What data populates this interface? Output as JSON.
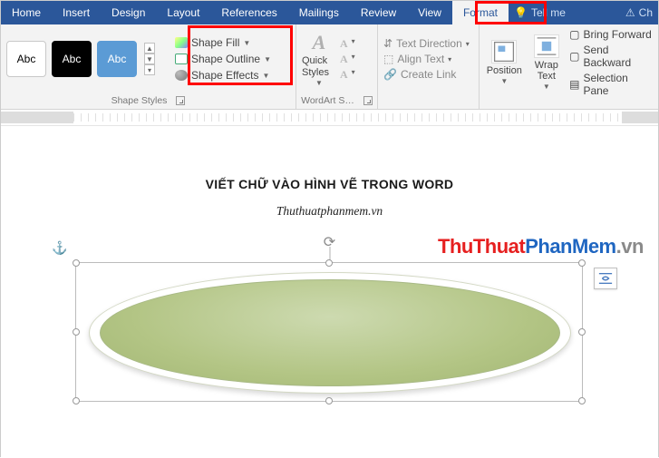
{
  "tabs": {
    "home": "Home",
    "insert": "Insert",
    "design": "Design",
    "layout": "Layout",
    "references": "References",
    "mailings": "Mailings",
    "review": "Review",
    "view": "View",
    "format": "Format",
    "tellme": "Tell me"
  },
  "ribbon": {
    "shape_styles": {
      "label": "Shape Styles",
      "swatch_text": "Abc",
      "fill": "Shape Fill",
      "outline": "Shape Outline",
      "effects": "Shape Effects"
    },
    "wordart_styles": {
      "label": "WordArt S…",
      "quick_styles": "Quick Styles"
    },
    "text": {
      "direction": "Text Direction",
      "align": "Align Text",
      "create_link": "Create Link"
    },
    "arrange": {
      "position": "Position",
      "wrap_text": "Wrap Text",
      "bring_forward": "Bring Forward",
      "send_backward": "Send Backward",
      "selection_pane": "Selection Pane"
    },
    "chrome_right": "Ch"
  },
  "document": {
    "heading": "VIẾT CHỮ VÀO HÌNH VẼ TRONG WORD",
    "subheading": "Thuthuatphanmem.vn"
  },
  "watermark": {
    "a": "ThuThuat",
    "b": "PhanMem",
    "c": ".vn"
  }
}
